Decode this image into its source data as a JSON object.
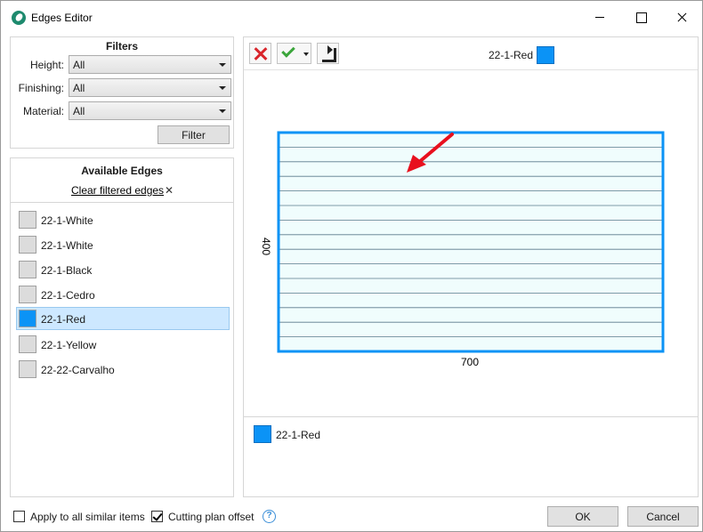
{
  "window": {
    "title": "Edges Editor"
  },
  "filters": {
    "title": "Filters",
    "height": {
      "label": "Height:",
      "value": "All"
    },
    "finishing": {
      "label": "Finishing:",
      "value": "All"
    },
    "material": {
      "label": "Material:",
      "value": "All"
    },
    "filter_button": "Filter"
  },
  "available_edges": {
    "title": "Available Edges",
    "clear_link": "Clear filtered edges",
    "items": [
      {
        "label": "22-1-White",
        "color": "#dcdcdc"
      },
      {
        "label": "22-1-White",
        "color": "#dcdcdc"
      },
      {
        "label": "22-1-Black",
        "color": "#dcdcdc"
      },
      {
        "label": "22-1-Cedro",
        "color": "#dcdcdc"
      },
      {
        "label": "22-1-Red",
        "color": "#0b93f6",
        "selected": true
      },
      {
        "label": "22-1-Yellow",
        "color": "#dcdcdc"
      },
      {
        "label": "22-22-Carvalho",
        "color": "#dcdcdc"
      }
    ]
  },
  "toolbar": {
    "cancel_icon": "red-x-icon",
    "apply_icon": "green-check-icon",
    "rotate_icon": "rotate-corner-icon",
    "current_edge": "22-1-Red",
    "current_edge_color": "#0b93f6"
  },
  "drawing": {
    "width_label": "700",
    "height_label": "400",
    "edge_color": "#0b93f6",
    "fill_color": "#f0fdfd",
    "stripe_color": "#5a7a8c",
    "arrow_color": "#e8101e"
  },
  "legend": {
    "label": "22-1-Red",
    "color": "#0b93f6"
  },
  "footer": {
    "apply_all_label": "Apply to all similar items",
    "apply_all_checked": false,
    "cutting_offset_label": "Cutting plan offset",
    "cutting_offset_checked": true,
    "help_icon": "?",
    "ok_label": "OK",
    "cancel_label": "Cancel"
  }
}
